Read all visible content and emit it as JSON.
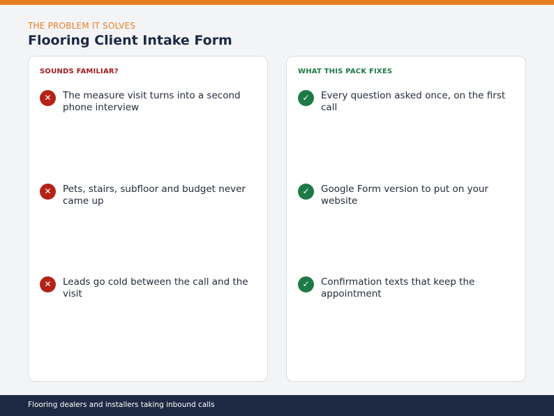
{
  "header": {
    "eyebrow": "THE PROBLEM IT SOLVES",
    "title": "Flooring Client Intake Form"
  },
  "problems": {
    "heading": "SOUNDS FAMILIAR?",
    "icon": "x-icon",
    "color": "#b42318",
    "items": [
      "The measure visit turns into a second phone interview",
      "Pets, stairs, subfloor and budget never came up",
      "Leads go cold between the call and the visit"
    ]
  },
  "fixes": {
    "heading": "WHAT THIS PACK FIXES",
    "icon": "check-icon",
    "color": "#1e7a45",
    "items": [
      "Every question asked once, on the first call",
      "Google Form version to put on your website",
      "Confirmation texts that keep the appointment"
    ]
  },
  "footer": {
    "text": "Flooring dealers and installers taking inbound calls"
  },
  "colors": {
    "accent": "#e67e22",
    "navy": "#1e2a44"
  }
}
